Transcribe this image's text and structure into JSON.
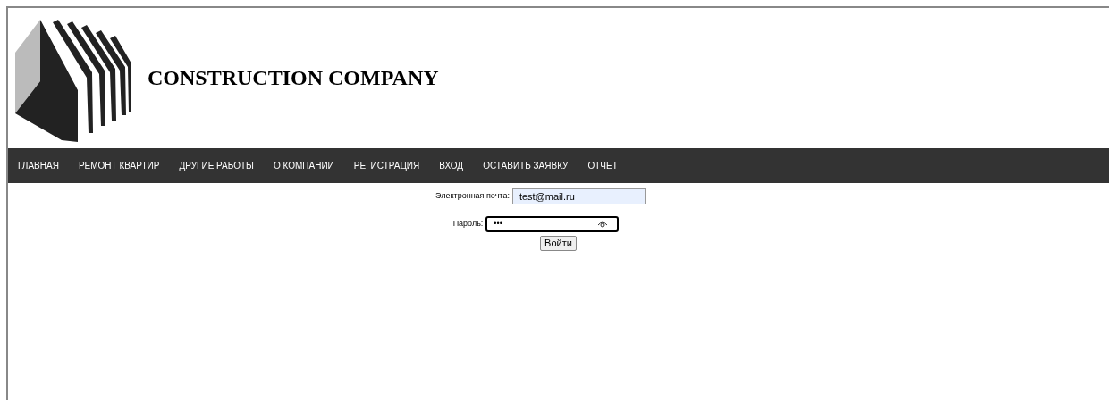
{
  "header": {
    "title": "CONSTRUCTION COMPANY"
  },
  "nav": [
    {
      "label": "ГЛАВНАЯ"
    },
    {
      "label": "РЕМОНТ КВАРТИР"
    },
    {
      "label": "ДРУГИЕ РАБОТЫ"
    },
    {
      "label": "О КОМПАНИИ"
    },
    {
      "label": "РЕГИСТРАЦИЯ"
    },
    {
      "label": "ВХОД"
    },
    {
      "label": "ОСТАВИТЬ ЗАЯВКУ"
    },
    {
      "label": "ОТЧЕТ"
    }
  ],
  "form": {
    "fields": [
      {
        "kind": "email",
        "label": "Электронная почта:",
        "value": "test@mail.ru",
        "focused": false,
        "autofilled": true
      },
      {
        "kind": "password",
        "label": "Пароль:",
        "value": "•••",
        "focused": true,
        "autofilled": false
      }
    ],
    "button": "Войти"
  }
}
